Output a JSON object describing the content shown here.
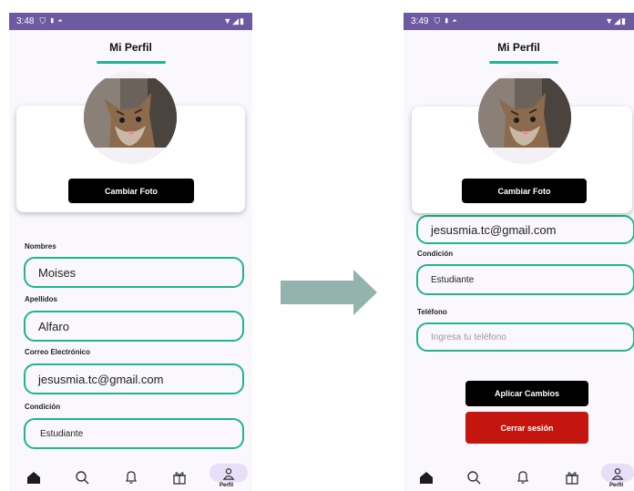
{
  "left_screen": {
    "status": {
      "time": "3:48"
    },
    "title": "Mi Perfil",
    "photo_button": "Cambiar Foto",
    "fields": [
      {
        "label": "Nombres",
        "value": "Moises"
      },
      {
        "label": "Apellidos",
        "value": "Alfaro"
      },
      {
        "label": "Correo Electrónico",
        "value": "jesusmia.tc@gmail.com"
      },
      {
        "label": "Condición",
        "value": "Estudiante"
      }
    ]
  },
  "right_screen": {
    "status": {
      "time": "3:49"
    },
    "title": "Mi Perfil",
    "photo_button": "Cambiar Foto",
    "email_value": "jesusmia.tc@gmail.com",
    "condition": {
      "label": "Condición",
      "value": "Estudiante"
    },
    "phone": {
      "label": "Teléfono",
      "placeholder": "Ingresa tu teléfono"
    },
    "apply_button": "Aplicar Cambios",
    "logout_button": "Cerrar sesión"
  },
  "navbar": {
    "items": [
      "home-icon",
      "search-icon",
      "bell-icon",
      "gift-icon",
      "profile-icon"
    ],
    "active_label": "Perfil"
  },
  "colors": {
    "accent": "#1fb58f",
    "status_bar": "#6e5aa0",
    "danger": "#c4160f",
    "arrow": "#95b3ad"
  }
}
